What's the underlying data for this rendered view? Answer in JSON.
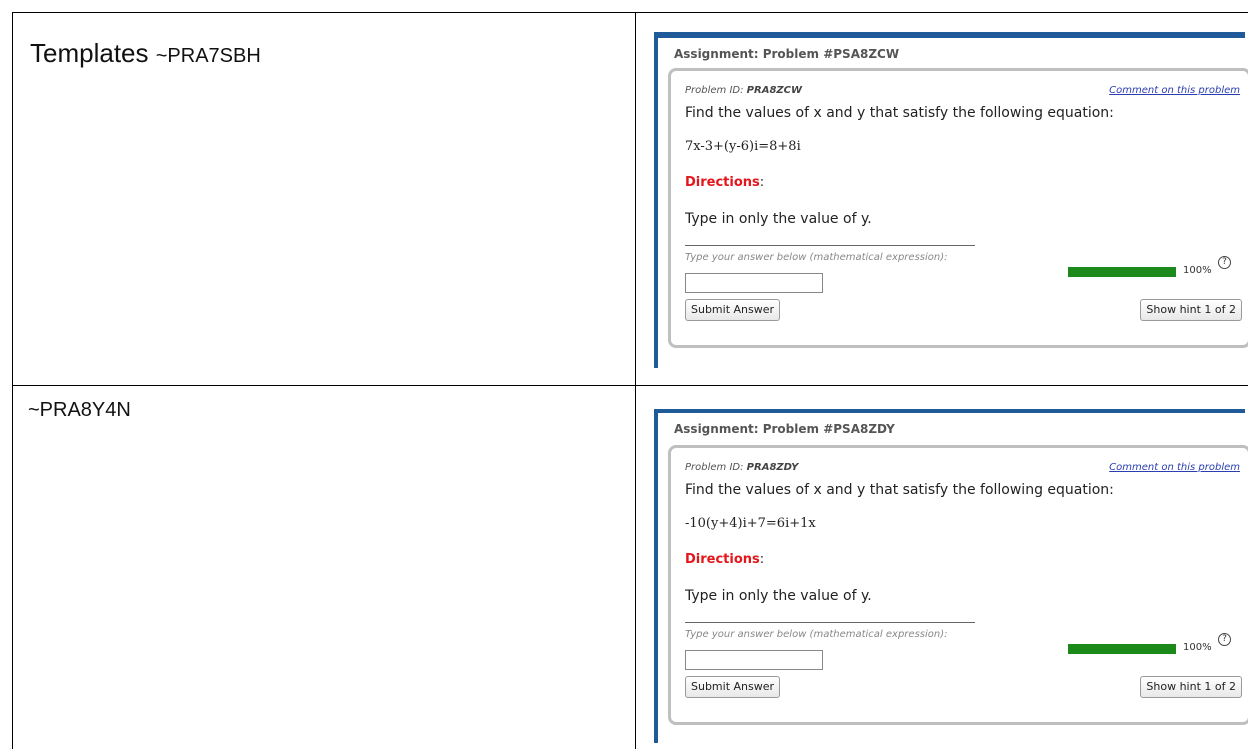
{
  "rows": [
    {
      "label": "Templates",
      "code": "~PRA7SBH",
      "widget": {
        "assignment_title": "Assignment: Problem #PSA8ZCW",
        "problem_id_label": "Problem ID:",
        "problem_id": "PRA8ZCW",
        "comment_link": "Comment on this problem",
        "question": "Find the values of x and y that satisfy the following equation:",
        "equation": "7x-3+(y-6)i=8+8i",
        "directions_label": "Directions",
        "directions_colon": ":",
        "directions_text": "Type in only the value of y.",
        "answer_label": "Type your answer below (mathematical expression):",
        "answer_value": "",
        "progress_percent": 100,
        "progress_label": "100%",
        "help_glyph": "?",
        "help_icon": "question-circle-icon",
        "submit_label": "Submit Answer",
        "hint_label": "Show hint 1 of 2"
      }
    },
    {
      "label": "",
      "code": "~PRA8Y4N",
      "widget": {
        "assignment_title": "Assignment: Problem #PSA8ZDY",
        "problem_id_label": "Problem ID:",
        "problem_id": "PRA8ZDY",
        "comment_link": "Comment on this problem",
        "question": "Find the values of x and y that satisfy the following equation:",
        "equation": "-10(y+4)i+7=6i+1x",
        "directions_label": "Directions",
        "directions_colon": ":",
        "directions_text": "Type in only the value of y.",
        "answer_label": "Type your answer below (mathematical expression):",
        "answer_value": "",
        "progress_percent": 100,
        "progress_label": "100%",
        "help_glyph": "?",
        "help_icon": "question-circle-icon",
        "submit_label": "Submit Answer",
        "hint_label": "Show hint 1 of 2"
      }
    }
  ],
  "colors": {
    "accent_blue": "#1f5b98",
    "directions_red": "#e3161b",
    "progress_green": "#1b8a1b",
    "link_blue": "#2a3eb1"
  }
}
